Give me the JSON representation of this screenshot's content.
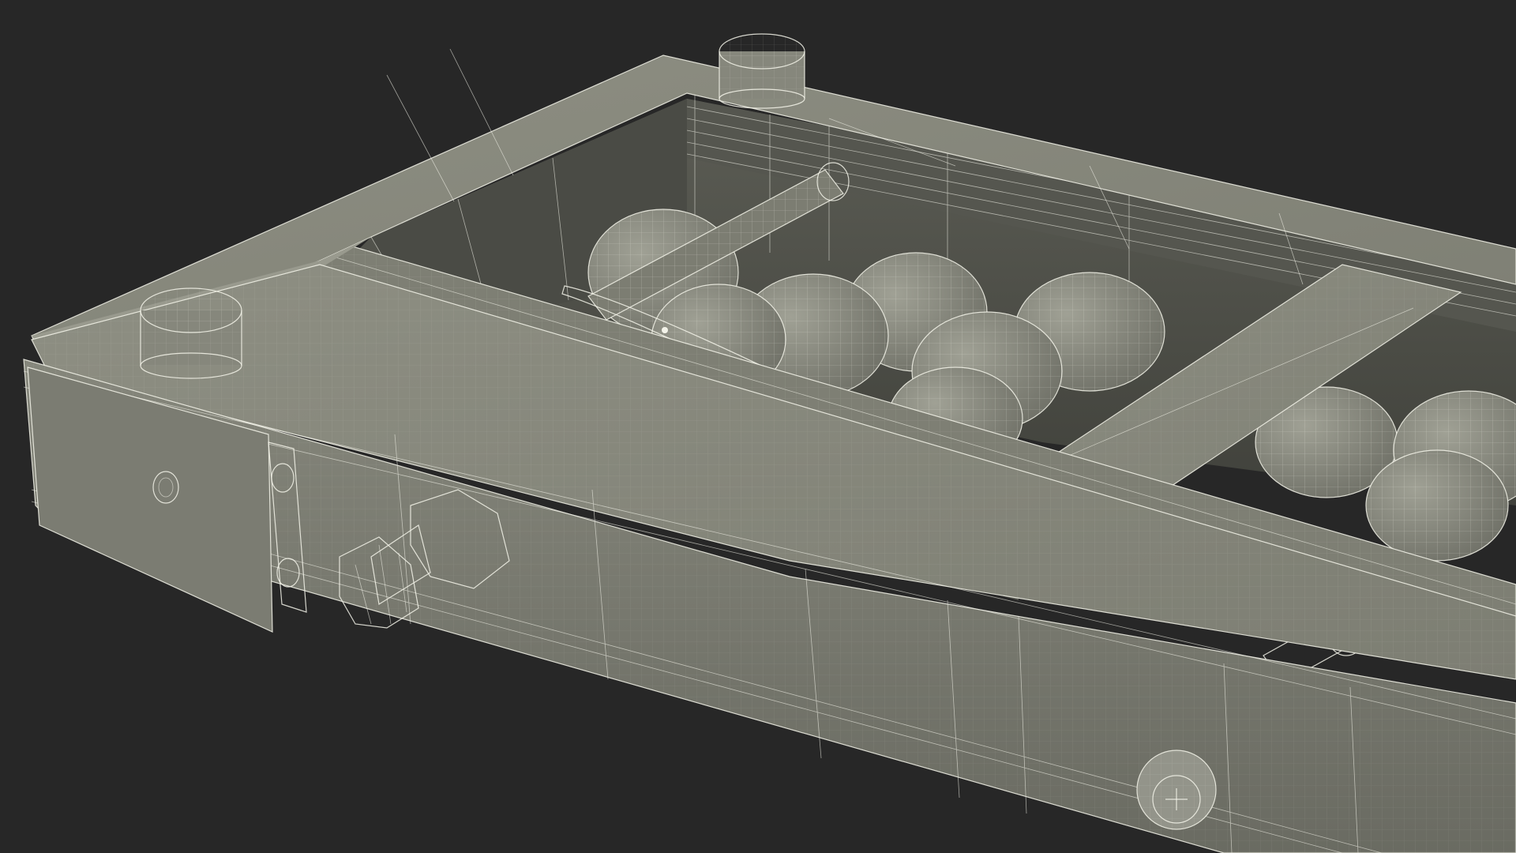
{
  "scene": {
    "background_color": "#272727",
    "model_color": "#8a8b7e",
    "model_shadow_color": "#4f5049",
    "wire_color": "#f4f4ea",
    "render_style": "wireframe-on-shaded"
  }
}
